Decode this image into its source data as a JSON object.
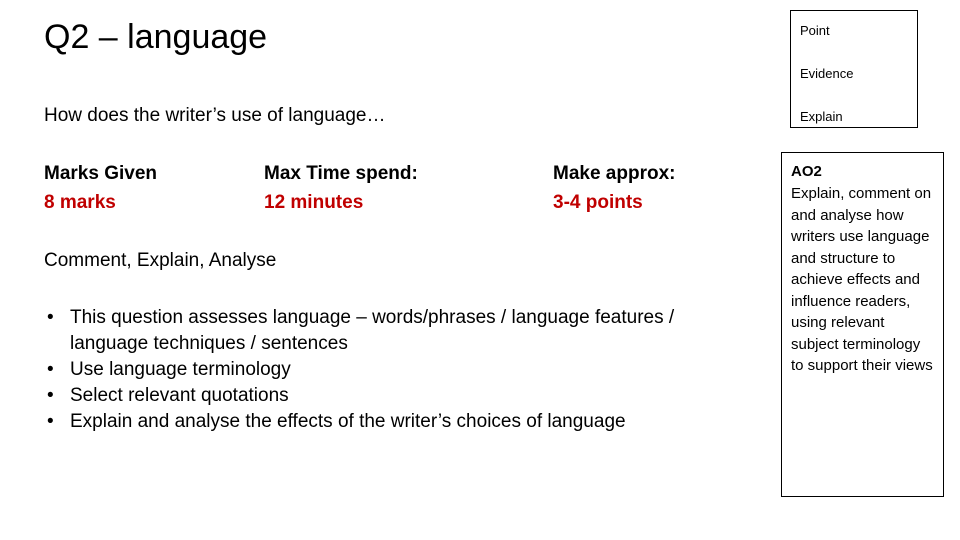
{
  "slide": {
    "title": "Q2 – language",
    "subtitle": "How does the writer’s use of language…",
    "info": {
      "marks_label": "Marks Given",
      "marks_value": "8 marks",
      "time_label": "Max Time spend:",
      "time_value": "12 minutes",
      "points_label": "Make approx:",
      "points_value": "3-4 points"
    },
    "skills_line": "Comment, Explain, Analyse",
    "bullets": [
      "This question assesses language – words/phrases / language features / language techniques / sentences",
      "Use language terminology",
      "Select relevant quotations",
      "Explain and analyse the effects of the writer’s choices of language"
    ],
    "bullet_marker": "•",
    "pee_box": {
      "items": [
        "Point",
        "Evidence",
        "Explain"
      ]
    },
    "ao_box": {
      "title": "AO2",
      "text": "Explain, comment on and analyse how writers use language and structure to achieve effects and influence readers, using relevant subject terminology to support their views"
    }
  },
  "colors": {
    "accent_red": "#c00000",
    "text": "#000000",
    "background": "#ffffff"
  }
}
